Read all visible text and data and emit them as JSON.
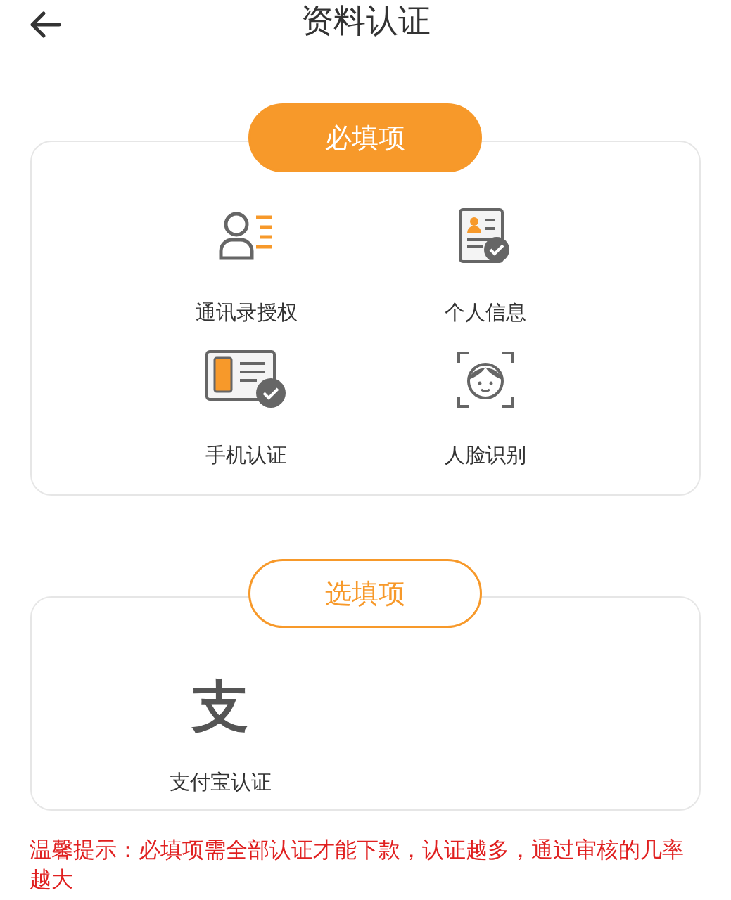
{
  "header": {
    "title": "资料认证"
  },
  "sections": [
    {
      "badge": "必填项",
      "kind": "filled",
      "items": [
        {
          "label": "通讯录授权",
          "kind": "contacts"
        },
        {
          "label": "个人信息",
          "kind": "id-card"
        },
        {
          "label": "手机认证",
          "kind": "phone"
        },
        {
          "label": "人脸识别",
          "kind": "face"
        }
      ]
    },
    {
      "badge": "选填项",
      "kind": "outlined",
      "items": [
        {
          "label": "支付宝认证",
          "kind": "glyph",
          "glyph": "支"
        }
      ]
    }
  ],
  "tip": "温馨提示：必填项需全部认证才能下款，认证越多，通过审核的几率越大"
}
